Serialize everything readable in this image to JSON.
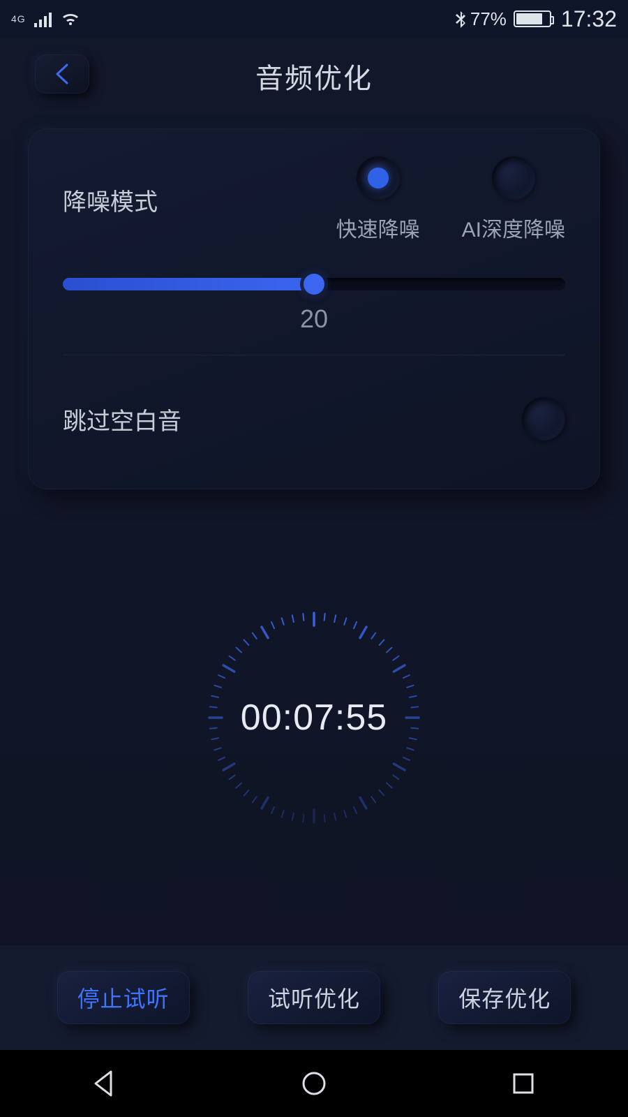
{
  "status": {
    "network_type": "4G",
    "battery_pct": "77%",
    "time": "17:32"
  },
  "header": {
    "title": "音频优化"
  },
  "noise": {
    "label": "降噪模式",
    "options": {
      "fast": "快速降噪",
      "ai": "AI深度降噪"
    },
    "selected": "fast",
    "slider_value": "20",
    "slider_percent": 50
  },
  "skip_silence": {
    "label": "跳过空白音",
    "enabled": false
  },
  "timer": {
    "display": "00:07:55"
  },
  "buttons": {
    "stop_preview": "停止试听",
    "preview_optimize": "试听优化",
    "save_optimize": "保存优化"
  }
}
